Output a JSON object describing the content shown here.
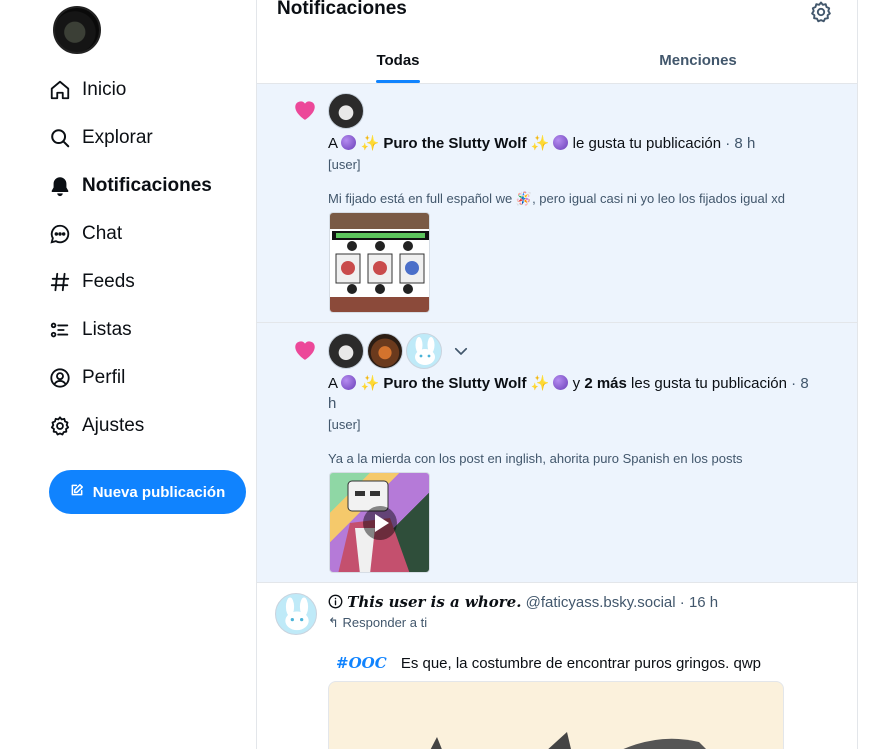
{
  "nav": {
    "items": [
      {
        "label": "Inicio",
        "icon": "home-icon"
      },
      {
        "label": "Explorar",
        "icon": "search-icon"
      },
      {
        "label": "Notificaciones",
        "icon": "bell-icon",
        "active": true
      },
      {
        "label": "Chat",
        "icon": "chat-icon"
      },
      {
        "label": "Feeds",
        "icon": "hash-icon"
      },
      {
        "label": "Listas",
        "icon": "list-icon"
      },
      {
        "label": "Perfil",
        "icon": "person-icon"
      },
      {
        "label": "Ajustes",
        "icon": "gear-icon"
      }
    ],
    "compose_label": "Nueva publicación"
  },
  "header": {
    "title": "Notificaciones"
  },
  "tabs": [
    {
      "label": "Todas",
      "active": true
    },
    {
      "label": "Menciones",
      "active": false
    }
  ],
  "notifications": [
    {
      "prefix": "A",
      "name": "Puro the Slutty Wolf",
      "action": "le gusta tu publicación",
      "time": "· 8 h",
      "tag": "[user]",
      "snippet": "Mi fijado está en full español we 🪅, pero igual casi ni yo leo los fijados igual xd",
      "unread": true
    },
    {
      "prefix": "A",
      "name": "Puro the Slutty Wolf",
      "joiner": "y",
      "more": "2 más",
      "action": "les gusta tu publicación",
      "time": "· 8",
      "time_wrap": "h",
      "tag": "[user]",
      "snippet": "Ya a la mierda con los post en inglish, ahorita puro Spanish en los posts",
      "unread": true
    }
  ],
  "post": {
    "display_name": "This user is a whore.",
    "handle": "@faticyass.bsky.social",
    "time": "· 16 h",
    "reply_label": "Responder a ti",
    "hashtag": "#OOC",
    "text": "Es que, la costumbre de encontrar puros gringos. qwp"
  },
  "colors": {
    "accent": "#1083fe",
    "like": "#ec4899",
    "unread_bg": "#edf4fd"
  }
}
